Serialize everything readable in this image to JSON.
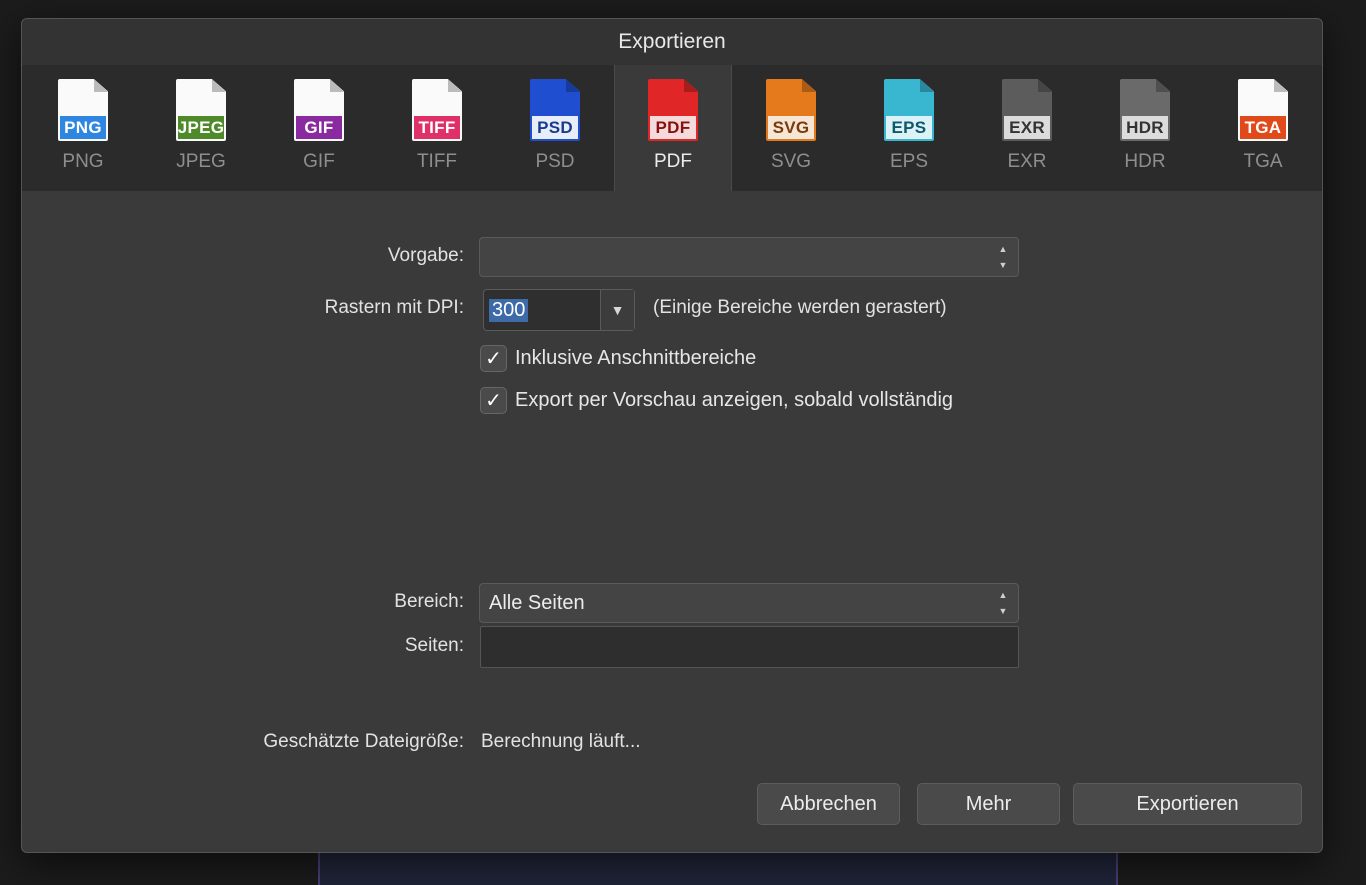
{
  "dialog": {
    "title": "Exportieren"
  },
  "formats": [
    {
      "key": "png",
      "label": "PNG",
      "badge": "PNG",
      "accent": "#2f86e0",
      "sheet": "#fafafa",
      "filled": false,
      "active": false
    },
    {
      "key": "jpeg",
      "label": "JPEG",
      "badge": "JPEG",
      "accent": "#4f8a2a",
      "sheet": "#fafafa",
      "filled": false,
      "active": false
    },
    {
      "key": "gif",
      "label": "GIF",
      "badge": "GIF",
      "accent": "#8a2aa0",
      "sheet": "#fafafa",
      "filled": false,
      "active": false
    },
    {
      "key": "tiff",
      "label": "TIFF",
      "badge": "TIFF",
      "accent": "#e0306a",
      "sheet": "#fafafa",
      "filled": false,
      "active": false
    },
    {
      "key": "psd",
      "label": "PSD",
      "badge": "PSD",
      "accent": "#1d3fa8",
      "sheet": "#1f4fd0",
      "filled": true,
      "badgebg": "#e8eef8",
      "badgefg": "#1a3a90",
      "active": false
    },
    {
      "key": "pdf",
      "label": "PDF",
      "badge": "PDF",
      "accent": "#c02020",
      "sheet": "#e02626",
      "filled": true,
      "badgebg": "#f4dada",
      "badgefg": "#8a1010",
      "active": true
    },
    {
      "key": "svg",
      "label": "SVG",
      "badge": "SVG",
      "accent": "#c8661a",
      "sheet": "#e57a1d",
      "filled": true,
      "badgebg": "#f6e6d6",
      "badgefg": "#7a3a0a",
      "active": false
    },
    {
      "key": "eps",
      "label": "EPS",
      "badge": "EPS",
      "accent": "#2aa0b8",
      "sheet": "#39b6d0",
      "filled": true,
      "badgebg": "#dcf2f6",
      "badgefg": "#0c5a6a",
      "active": false
    },
    {
      "key": "exr",
      "label": "EXR",
      "badge": "EXR",
      "accent": "#555555",
      "sheet": "#5c5c5c",
      "filled": true,
      "badgebg": "#dcdcdc",
      "badgefg": "#333333",
      "active": false
    },
    {
      "key": "hdr",
      "label": "HDR",
      "badge": "HDR",
      "accent": "#666666",
      "sheet": "#6a6a6a",
      "filled": true,
      "badgebg": "#dcdcdc",
      "badgefg": "#333333",
      "active": false
    },
    {
      "key": "tga",
      "label": "TGA",
      "badge": "TGA",
      "accent": "#e04a1a",
      "sheet": "#fafafa",
      "filled": false,
      "active": false
    }
  ],
  "form": {
    "preset_label": "Vorgabe:",
    "preset_value": "",
    "dpi_label": "Rastern mit DPI:",
    "dpi_value": "300",
    "dpi_note": "(Einige Bereiche werden gerastert)",
    "bleed_label": "Inklusive Anschnittbereiche",
    "bleed_checked": true,
    "preview_label": "Export per Vorschau anzeigen, sobald vollständig",
    "preview_checked": true,
    "range_label": "Bereich:",
    "range_value": "Alle Seiten",
    "pages_label": "Seiten:",
    "pages_value": "",
    "size_label": "Geschätzte Dateigröße:",
    "size_value": "Berechnung läuft..."
  },
  "buttons": {
    "cancel": "Abbrechen",
    "more": "Mehr",
    "export": "Exportieren"
  }
}
